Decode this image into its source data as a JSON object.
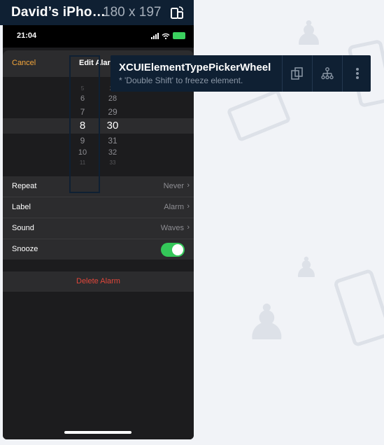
{
  "inspector": {
    "device_name": "David’s iPho…",
    "dimensions": "180 x 197",
    "rotate_icon": "device-rotate-icon"
  },
  "status_bar": {
    "time": "21:04"
  },
  "alarm_editor": {
    "cancel_label": "Cancel",
    "title": "Edit Alarm"
  },
  "picker": {
    "hours": [
      "5",
      "6",
      "7",
      "8",
      "9",
      "10",
      "11"
    ],
    "minutes": [
      "27",
      "28",
      "29",
      "30",
      "31",
      "32",
      "33"
    ],
    "selected_hour": "8",
    "selected_minute": "30"
  },
  "settings": {
    "rows": [
      {
        "label": "Repeat",
        "value": "Never"
      },
      {
        "label": "Label",
        "value": "Alarm"
      },
      {
        "label": "Sound",
        "value": "Waves"
      },
      {
        "label": "Snooze",
        "value": "",
        "toggle_on": true
      }
    ]
  },
  "delete_label": "Delete Alarm",
  "tooltip": {
    "element_type": "XCUIElementTypePickerWheel",
    "hint": "* 'Double Shift' to freeze element.",
    "icons": [
      "copy-icon",
      "tree-icon",
      "more-icon"
    ]
  },
  "colors": {
    "accent": "#f4a63b",
    "destructive": "#e0473b",
    "toggle_on": "#34c759",
    "inspector_bg": "#0f2033"
  }
}
